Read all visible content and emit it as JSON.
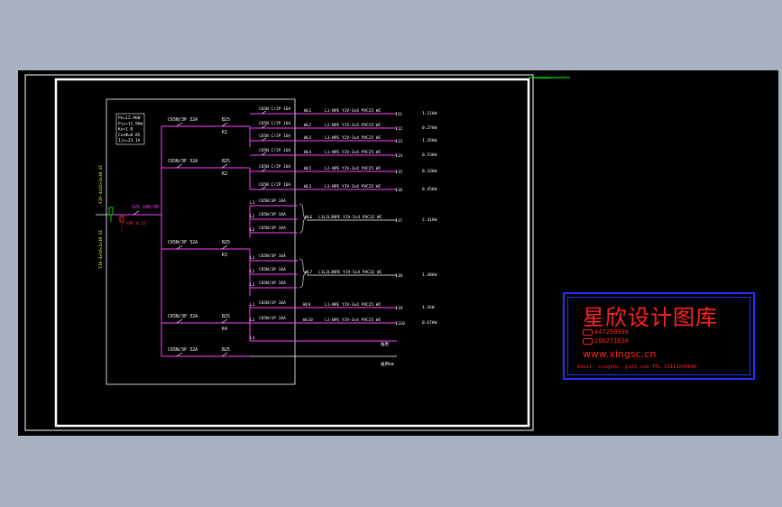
{
  "colors": {
    "background": "#a9b0c0",
    "canvas": "#000000",
    "frame": "#ffffff",
    "bus": "#ff40ff",
    "cable_text": "#ffffff",
    "stamp_text": "#ff2020",
    "stamp_border": "#2233ff"
  },
  "panel_params": [
    "Pe=12.9kW",
    "Pjs=12.9kW",
    "Kx=1.0",
    "CosΦ=0.85",
    "Ijs=23.1A"
  ],
  "incoming": {
    "cable_upper": "YJV-4x16+1x10 SC",
    "cable_lower": "YJV-4x16+1x10 SC",
    "main_breaker": "S25-100/3P",
    "spd": "SPD-0.22"
  },
  "groups": [
    {
      "breaker": "C65N/3P 32A",
      "rcd": "B25",
      "k": "K1"
    },
    {
      "breaker": "C65N/3P 32A",
      "rcd": "B25",
      "k": "K2"
    },
    {
      "breaker": "C65N/3P 32A",
      "rcd": "B25",
      "k": "K3"
    },
    {
      "breaker": "C65N/3P 32A",
      "rcd": "B25",
      "k": "K4"
    },
    {
      "breaker": "C65N/3P 32A",
      "rcd": "B25",
      "k": ""
    }
  ],
  "circuits_single": [
    {
      "phase": "L1",
      "breaker": "C65N C/2P 16A",
      "id": "WL1",
      "cable": "L1-NPE YJV-3x4 PVC25 WC",
      "num": "111",
      "kw": "1.21kW"
    },
    {
      "phase": "L2",
      "breaker": "C65N C/2P 16A",
      "id": "WL2",
      "cable": "L2-NPE YJV-3x4 PVC25 WC",
      "num": "112",
      "kw": "0.27kW"
    },
    {
      "phase": "L3",
      "breaker": "C65N C/2P 16A",
      "id": "WL3",
      "cable": "L3-NPE YJV-3x4 PVC25 WC",
      "num": "113",
      "kw": "1.35kW"
    },
    {
      "phase": "L1",
      "breaker": "C65N C/2P 16A",
      "id": "WL4",
      "cable": "L1-NPE YJV-3x4 PVC25 WC",
      "num": "114",
      "kw": "0.53kW"
    },
    {
      "phase": "L2",
      "breaker": "C65N C/2P 16A",
      "id": "WL5",
      "cable": "L2-NPE YJV-3x4 PVC25 WC",
      "num": "115",
      "kw": "0.33kW"
    },
    {
      "phase": "L3",
      "breaker": "C65N C/2P 16A",
      "id": "WL3",
      "cable": "L3-NPE YJV-3x4 PVC25 WC",
      "num": "116",
      "kw": "0.45kW"
    }
  ],
  "circuits_three": [
    {
      "breaker": "C65N/3P 16A",
      "id": "WL6",
      "cable": "L1L2L3NPE YJV-5x4 PVC32 WC",
      "num": "117",
      "kw": "2.41kW"
    },
    {
      "breaker": "C65N/3P 16A",
      "id": "WL7",
      "cable": "L1L2L3NPE YJV-5x4 PVC32 WC",
      "num": "118",
      "kw": "1.48kW"
    }
  ],
  "circuits_last": [
    {
      "phase": "L1",
      "breaker": "C65N/1P 16A",
      "id": "WL9",
      "cable": "L1-NPE YJV-3x4 PVC25 WC",
      "num": "119",
      "kw": "1.2kW"
    },
    {
      "phase": "L2",
      "breaker": "C65N/1P 16A",
      "id": "WL10",
      "cable": "L2-NPE YJV-3x4 PVC25 WC",
      "num": "1110",
      "kw": "0.67kW"
    },
    {
      "phase": "L3",
      "breaker": "",
      "id": "",
      "cable": "",
      "num": "",
      "kw": ""
    }
  ],
  "spare": [
    "备用",
    "备用kW"
  ],
  "phase_labels": [
    "L1",
    "L2",
    "L3"
  ],
  "tag_top": "———————",
  "stamp": {
    "title": "星欣设计图库",
    "qq1": "447250930",
    "qq2": "286271830",
    "url": "www.xingsc.cn",
    "contact": "Email: xingkhu..@163.com  TEL 13111040690"
  }
}
